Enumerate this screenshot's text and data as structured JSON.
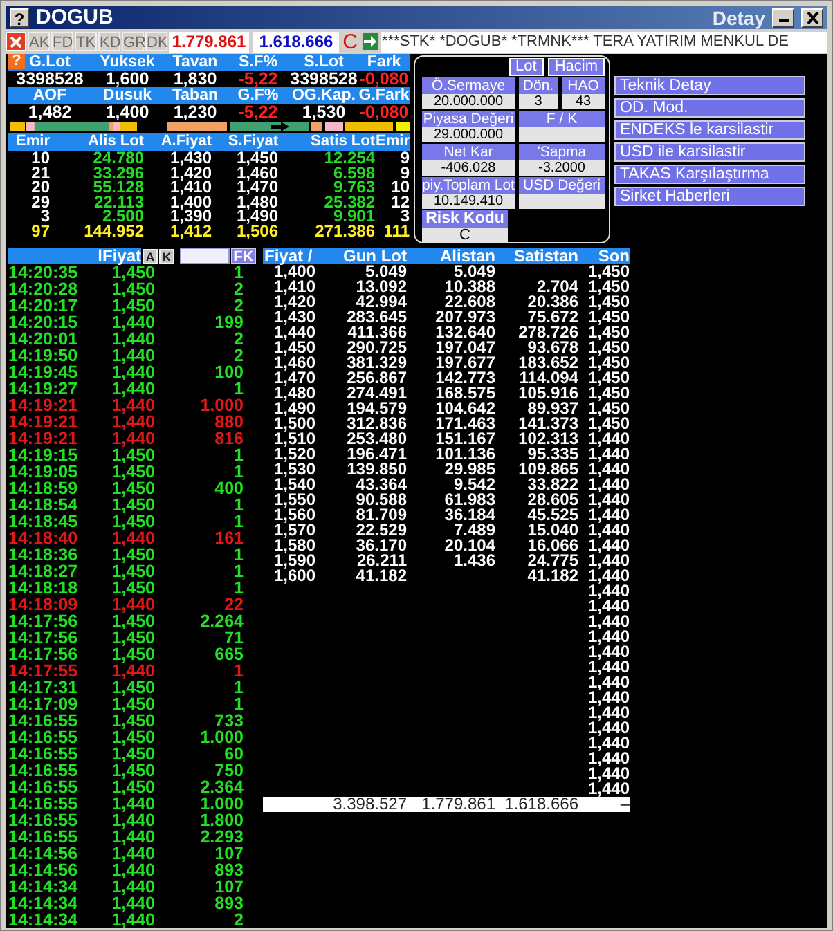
{
  "window": {
    "icon": "?",
    "title": "DOGUB",
    "detail_title": "Detay"
  },
  "toolbar": {
    "tabs": [
      {
        "label": "AK",
        "disabled": true
      },
      {
        "label": "FD",
        "disabled": true
      },
      {
        "label": "TK",
        "disabled": true
      },
      {
        "label": "KD",
        "disabled": true
      },
      {
        "label": "GR",
        "disabled": true
      },
      {
        "label": "DK",
        "disabled": true
      }
    ],
    "buy_total": "1.779.861",
    "sell_total": "1.618.666",
    "status": "C",
    "ticker": "***STK* *DOGUB* *TRMNK*** TERA YATIRIM MENKUL DE"
  },
  "summary": {
    "help": "?",
    "rows": [
      {
        "kind": "header",
        "cells": [
          {
            "text": "G.Lot"
          },
          {
            "text": "Yuksek"
          },
          {
            "text": "Tavan"
          },
          {
            "text": "S.F%"
          },
          {
            "text": "S.Lot"
          },
          {
            "text": "Fark"
          }
        ]
      },
      {
        "kind": "values",
        "cells": [
          {
            "text": "3398528",
            "negative": false
          },
          {
            "text": "1,600",
            "negative": false
          },
          {
            "text": "1,830",
            "negative": false
          },
          {
            "text": "-5,22",
            "negative": true
          },
          {
            "text": "3398528",
            "negative": false
          },
          {
            "text": "-0,080",
            "negative": true
          }
        ]
      },
      {
        "kind": "header",
        "cells": [
          {
            "text": "AOF"
          },
          {
            "text": "Dusuk"
          },
          {
            "text": "Taban"
          },
          {
            "text": "G.F%"
          },
          {
            "text": "OG.Kap."
          },
          {
            "text": "G.Fark"
          }
        ]
      },
      {
        "kind": "values",
        "cells": [
          {
            "text": "1,482",
            "negative": false
          },
          {
            "text": "1,400",
            "negative": false
          },
          {
            "text": "1,230",
            "negative": false
          },
          {
            "text": "-5,22",
            "negative": true
          },
          {
            "text": "1,530",
            "negative": false
          },
          {
            "text": "-0,080",
            "negative": true
          }
        ]
      }
    ]
  },
  "depth": {
    "columns": [
      "Emir",
      "Alis Lot",
      "A.Fiyat",
      "S.Fiyat",
      "Satis Lot",
      "Emir"
    ],
    "rows": [
      {
        "kind": "level",
        "cells": [
          "10",
          "24.780",
          "1,430",
          "1,450",
          "12.254",
          "9"
        ]
      },
      {
        "kind": "level",
        "cells": [
          "21",
          "33.296",
          "1,420",
          "1,460",
          "6.598",
          "9"
        ]
      },
      {
        "kind": "level",
        "cells": [
          "20",
          "55.128",
          "1,410",
          "1,470",
          "9.763",
          "10"
        ]
      },
      {
        "kind": "level",
        "cells": [
          "29",
          "22.113",
          "1,400",
          "1,480",
          "25.382",
          "12"
        ]
      },
      {
        "kind": "level",
        "cells": [
          "3",
          "2.500",
          "1,390",
          "1,490",
          "9.901",
          "3"
        ]
      },
      {
        "kind": "total",
        "cells": [
          "97",
          "144.952",
          "1,412",
          "1,506",
          "271.386",
          "111"
        ]
      }
    ]
  },
  "info": {
    "toggles": [
      {
        "label": "Lot"
      },
      {
        "label": "Hacim"
      }
    ],
    "rows": [
      [
        {
          "label": "Ö.Sermaye",
          "value": "20.000.000"
        },
        {
          "label": "Dön.",
          "value": "3"
        },
        {
          "label": "HAO",
          "value": "43"
        }
      ],
      [
        {
          "label": "Piyasa Değeri",
          "value": "29.000.000"
        },
        {
          "label": "F / K"
        }
      ],
      [
        {
          "label": "Net Kar",
          "value": "-406.028"
        },
        {
          "label": "'Sapma",
          "value": "-3.2000"
        }
      ],
      [
        {
          "label": "piy.Toplam Lot",
          "value": "10.149.410"
        },
        {
          "label": "USD Değeri"
        }
      ]
    ],
    "risk": {
      "label": "Risk Kodu",
      "value": "C"
    }
  },
  "links": [
    "Teknik Detay",
    "OD. Mod.",
    "ENDEKS le karsilastir",
    "USD ile karsilastir",
    "TAKAS Karşılaştırma",
    "Sirket Haberleri"
  ],
  "trades": {
    "header": "lFiyat",
    "buttons": [
      "A",
      "K"
    ],
    "filter_button": "FK",
    "rows": [
      {
        "time": "14:20:35",
        "price": "1,450",
        "lot": "1",
        "kind": "buy"
      },
      {
        "time": "14:20:28",
        "price": "1,450",
        "lot": "2",
        "kind": "buy"
      },
      {
        "time": "14:20:17",
        "price": "1,450",
        "lot": "2",
        "kind": "buy"
      },
      {
        "time": "14:20:15",
        "price": "1,440",
        "lot": "199",
        "kind": "buy"
      },
      {
        "time": "14:20:01",
        "price": "1,440",
        "lot": "2",
        "kind": "buy"
      },
      {
        "time": "14:19:50",
        "price": "1,440",
        "lot": "2",
        "kind": "buy"
      },
      {
        "time": "14:19:45",
        "price": "1,440",
        "lot": "100",
        "kind": "buy"
      },
      {
        "time": "14:19:27",
        "price": "1,440",
        "lot": "1",
        "kind": "buy"
      },
      {
        "time": "14:19:21",
        "price": "1,440",
        "lot": "1.000",
        "kind": "sell"
      },
      {
        "time": "14:19:21",
        "price": "1,440",
        "lot": "880",
        "kind": "sell"
      },
      {
        "time": "14:19:21",
        "price": "1,440",
        "lot": "816",
        "kind": "sell"
      },
      {
        "time": "14:19:15",
        "price": "1,450",
        "lot": "1",
        "kind": "buy"
      },
      {
        "time": "14:19:05",
        "price": "1,450",
        "lot": "1",
        "kind": "buy"
      },
      {
        "time": "14:18:59",
        "price": "1,450",
        "lot": "400",
        "kind": "buy"
      },
      {
        "time": "14:18:54",
        "price": "1,450",
        "lot": "1",
        "kind": "buy"
      },
      {
        "time": "14:18:45",
        "price": "1,450",
        "lot": "1",
        "kind": "buy"
      },
      {
        "time": "14:18:40",
        "price": "1,440",
        "lot": "161",
        "kind": "sell"
      },
      {
        "time": "14:18:36",
        "price": "1,450",
        "lot": "1",
        "kind": "buy"
      },
      {
        "time": "14:18:27",
        "price": "1,450",
        "lot": "1",
        "kind": "buy"
      },
      {
        "time": "14:18:18",
        "price": "1,450",
        "lot": "1",
        "kind": "buy"
      },
      {
        "time": "14:18:09",
        "price": "1,440",
        "lot": "22",
        "kind": "sell"
      },
      {
        "time": "14:17:56",
        "price": "1,450",
        "lot": "2.264",
        "kind": "buy"
      },
      {
        "time": "14:17:56",
        "price": "1,450",
        "lot": "71",
        "kind": "buy"
      },
      {
        "time": "14:17:56",
        "price": "1,450",
        "lot": "665",
        "kind": "buy"
      },
      {
        "time": "14:17:55",
        "price": "1,440",
        "lot": "1",
        "kind": "sell"
      },
      {
        "time": "14:17:31",
        "price": "1,450",
        "lot": "1",
        "kind": "buy"
      },
      {
        "time": "14:17:09",
        "price": "1,450",
        "lot": "1",
        "kind": "buy"
      },
      {
        "time": "14:16:55",
        "price": "1,450",
        "lot": "733",
        "kind": "buy"
      },
      {
        "time": "14:16:55",
        "price": "1,450",
        "lot": "1.000",
        "kind": "buy"
      },
      {
        "time": "14:16:55",
        "price": "1,450",
        "lot": "60",
        "kind": "buy"
      },
      {
        "time": "14:16:55",
        "price": "1,450",
        "lot": "750",
        "kind": "buy"
      },
      {
        "time": "14:16:55",
        "price": "1,450",
        "lot": "2.364",
        "kind": "buy"
      },
      {
        "time": "14:16:55",
        "price": "1,440",
        "lot": "1.000",
        "kind": "buy"
      },
      {
        "time": "14:16:55",
        "price": "1,440",
        "lot": "1.800",
        "kind": "buy"
      },
      {
        "time": "14:16:55",
        "price": "1,440",
        "lot": "2.293",
        "kind": "buy"
      },
      {
        "time": "14:14:56",
        "price": "1,440",
        "lot": "107",
        "kind": "buy"
      },
      {
        "time": "14:14:56",
        "price": "1,440",
        "lot": "893",
        "kind": "buy"
      },
      {
        "time": "14:14:34",
        "price": "1,440",
        "lot": "107",
        "kind": "buy"
      },
      {
        "time": "14:14:34",
        "price": "1,440",
        "lot": "893",
        "kind": "buy"
      },
      {
        "time": "14:14:34",
        "price": "1,440",
        "lot": "2",
        "kind": "buy"
      }
    ]
  },
  "price_table": {
    "columns": [
      "Fiyat /",
      "Gun Lot",
      "Alistan",
      "Satistan",
      "Son"
    ],
    "rows": [
      {
        "price": "1,400",
        "gun_lot": "5.049",
        "alistan": "5.049",
        "son": "1,450"
      },
      {
        "price": "1,410",
        "gun_lot": "13.092",
        "alistan": "10.388",
        "satistan": "2.704",
        "son": "1,450"
      },
      {
        "price": "1,420",
        "gun_lot": "42.994",
        "alistan": "22.608",
        "satistan": "20.386",
        "son": "1,450"
      },
      {
        "price": "1,430",
        "gun_lot": "283.645",
        "alistan": "207.973",
        "satistan": "75.672",
        "son": "1,450"
      },
      {
        "price": "1,440",
        "gun_lot": "411.366",
        "alistan": "132.640",
        "satistan": "278.726",
        "son": "1,450"
      },
      {
        "price": "1,450",
        "gun_lot": "290.725",
        "alistan": "197.047",
        "satistan": "93.678",
        "son": "1,450"
      },
      {
        "price": "1,460",
        "gun_lot": "381.329",
        "alistan": "197.677",
        "satistan": "183.652",
        "son": "1,450"
      },
      {
        "price": "1,470",
        "gun_lot": "256.867",
        "alistan": "142.773",
        "satistan": "114.094",
        "son": "1,450"
      },
      {
        "price": "1,480",
        "gun_lot": "274.491",
        "alistan": "168.575",
        "satistan": "105.916",
        "son": "1,450"
      },
      {
        "price": "1,490",
        "gun_lot": "194.579",
        "alistan": "104.642",
        "satistan": "89.937",
        "son": "1,450"
      },
      {
        "price": "1,500",
        "gun_lot": "312.836",
        "alistan": "171.463",
        "satistan": "141.373",
        "son": "1,450"
      },
      {
        "price": "1,510",
        "gun_lot": "253.480",
        "alistan": "151.167",
        "satistan": "102.313",
        "son": "1,440"
      },
      {
        "price": "1,520",
        "gun_lot": "196.471",
        "alistan": "101.136",
        "satistan": "95.335",
        "son": "1,440"
      },
      {
        "price": "1,530",
        "gun_lot": "139.850",
        "alistan": "29.985",
        "satistan": "109.865",
        "son": "1,440"
      },
      {
        "price": "1,540",
        "gun_lot": "43.364",
        "alistan": "9.542",
        "satistan": "33.822",
        "son": "1,440"
      },
      {
        "price": "1,550",
        "gun_lot": "90.588",
        "alistan": "61.983",
        "satistan": "28.605",
        "son": "1,440"
      },
      {
        "price": "1,560",
        "gun_lot": "81.709",
        "alistan": "36.184",
        "satistan": "45.525",
        "son": "1,440"
      },
      {
        "price": "1,570",
        "gun_lot": "22.529",
        "alistan": "7.489",
        "satistan": "15.040",
        "son": "1,440"
      },
      {
        "price": "1,580",
        "gun_lot": "36.170",
        "alistan": "20.104",
        "satistan": "16.066",
        "son": "1,440"
      },
      {
        "price": "1,590",
        "gun_lot": "26.211",
        "alistan": "1.436",
        "satistan": "24.775",
        "son": "1,440"
      },
      {
        "price": "1,600",
        "gun_lot": "41.182",
        "satistan": "41.182",
        "son": "1,440"
      },
      {
        "son": "1,440"
      },
      {
        "son": "1,440"
      },
      {
        "son": "1,440"
      },
      {
        "son": "1,440"
      },
      {
        "son": "1,440"
      },
      {
        "son": "1,440"
      },
      {
        "son": "1,440"
      },
      {
        "son": "1,440"
      },
      {
        "son": "1,440"
      },
      {
        "son": "1,440"
      },
      {
        "son": "1,440"
      },
      {
        "son": "1,440"
      },
      {
        "son": "1,440"
      },
      {
        "son": "1,440"
      }
    ],
    "totals": {
      "gun_lot": "3.398.527",
      "alistan": "1.779.861",
      "satistan": "1.618.666",
      "son": "–"
    }
  }
}
